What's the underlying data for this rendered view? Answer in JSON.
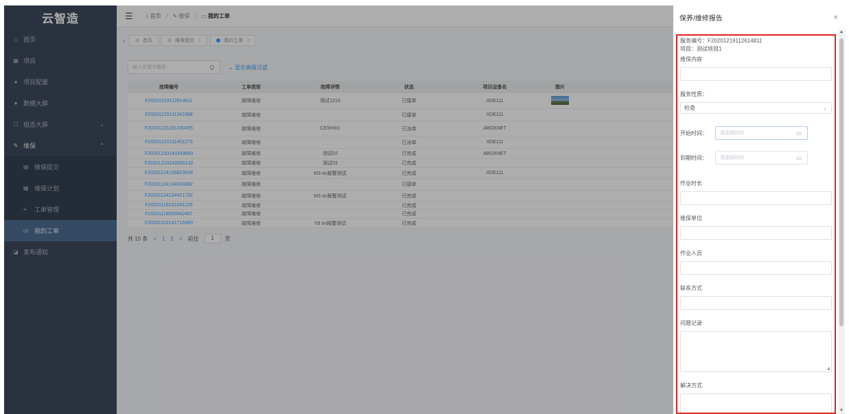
{
  "sidebar": {
    "logo": "云智造",
    "items": [
      {
        "label": "首页",
        "icon": "home-icon",
        "glyph": "⌂"
      },
      {
        "label": "项目",
        "icon": "grid-icon",
        "glyph": "▦"
      },
      {
        "label": "项目配置",
        "icon": "gear-icon",
        "glyph": "●"
      },
      {
        "label": "数据大屏",
        "icon": "dashboard-icon",
        "glyph": "●"
      },
      {
        "label": "组态大屏",
        "icon": "monitor-icon",
        "glyph": "☐",
        "arrow": "⌄"
      },
      {
        "label": "维保",
        "icon": "wrench-icon",
        "glyph": "✎",
        "arrow": "⌃"
      }
    ],
    "sub_items": [
      {
        "label": "维保提交",
        "icon": "form-icon",
        "glyph": "▤"
      },
      {
        "label": "维保计划",
        "icon": "calendar-icon",
        "glyph": "▦"
      },
      {
        "label": "工单管理",
        "icon": "list-icon",
        "glyph": "≡"
      },
      {
        "label": "我的工单",
        "icon": "ticket-icon",
        "glyph": "▭"
      }
    ],
    "after": [
      {
        "label": "发布通知",
        "icon": "notice-icon",
        "glyph": "◪"
      }
    ]
  },
  "topbar": {
    "crumbs": [
      "首页",
      "维保",
      "我的工单"
    ]
  },
  "tabs": [
    {
      "label": "首页",
      "active": false
    },
    {
      "label": "维保提交",
      "active": false
    },
    {
      "label": "我的工单",
      "active": true
    }
  ],
  "filter": {
    "placeholder": "输入关键字搜索...",
    "advanced": "显示高级过滤"
  },
  "table": {
    "headers": [
      "故障编号",
      "工单类型",
      "故障详情",
      "状态",
      "项目设备名",
      "图片"
    ],
    "rows": [
      {
        "code": "F20201219112614811",
        "type": "故障维修",
        "detail": "测试1219",
        "status": "已接单",
        "device": "XDE111",
        "img": true,
        "h": 23
      },
      {
        "code": "F20201215111341088",
        "type": "故障维修",
        "detail": "",
        "status": "已接单",
        "device": "XDE111",
        "img": false,
        "h": 18
      },
      {
        "code": "F20201221161240455",
        "type": "故障维修",
        "detail": "CESHI01",
        "status": "已派单",
        "device": "ABOXNET",
        "img": false,
        "h": 22
      },
      {
        "code": "F20201215111401275",
        "type": "故障维修",
        "detail": "",
        "status": "已派单",
        "device": "XDE111",
        "img": false,
        "h": 18
      },
      {
        "code": "F20201210143343660",
        "type": "故障维修",
        "detail": "测试02",
        "status": "已完成",
        "device": "ABOXNET",
        "img": false,
        "h": 15
      },
      {
        "code": "F20201210143350132",
        "type": "故障维修",
        "detail": "测试03",
        "status": "已完成",
        "device": "",
        "img": false,
        "h": 13
      },
      {
        "code": "F20201124135823639",
        "type": "故障维修",
        "detail": "M3 on报警测试",
        "status": "已完成",
        "device": "XDE111",
        "img": false,
        "h": 16
      },
      {
        "code": "F20201124134524882",
        "type": "故障维修",
        "detail": "",
        "status": "已接单",
        "device": "",
        "img": false,
        "h": 17
      },
      {
        "code": "F20201124134421732",
        "type": "故障维修",
        "detail": "M3 on报警测试",
        "status": "已完成",
        "device": "",
        "img": false,
        "h": 16
      },
      {
        "code": "F20201118152241226",
        "type": "故障维修",
        "detail": "",
        "status": "已完成",
        "device": "",
        "img": false,
        "h": 12
      },
      {
        "code": "F20201118090942487",
        "type": "故障维修",
        "detail": "",
        "status": "已完成",
        "device": "",
        "img": false,
        "h": 13
      },
      {
        "code": "F20201102141716480",
        "type": "故障维修",
        "detail": "Y8 on报警测试",
        "status": "已完成",
        "device": "",
        "img": false,
        "h": 14
      }
    ]
  },
  "pager": {
    "total": "共 15 条",
    "prev": "<",
    "pages": [
      "1",
      "2"
    ],
    "next": ">",
    "goto": "前往",
    "page_value": "1",
    "page_suffix": "页"
  },
  "drawer": {
    "title": "保养/维修报告",
    "service_no": "服务编号：F20201219112614811",
    "project": "项目：测试项目1",
    "labels": {
      "content": "维保内容",
      "nature": "服务性质：",
      "start": "开始时间：",
      "due": "到期时间：",
      "duration": "作业时长",
      "unit": "维保单位",
      "staff": "作业人员",
      "contact": "联系方式",
      "problem": "问题记录",
      "solution": "解决方式"
    },
    "nature_value": "检查",
    "date_placeholder": "请选择时间"
  }
}
